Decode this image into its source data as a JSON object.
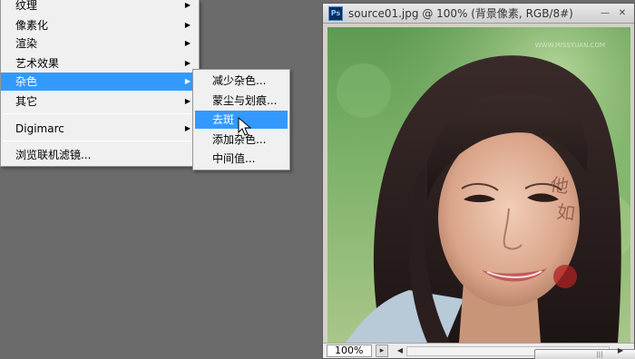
{
  "filter_menu": {
    "items": [
      {
        "label": "纹理",
        "has_submenu": true
      },
      {
        "label": "像素化",
        "has_submenu": true
      },
      {
        "label": "渲染",
        "has_submenu": true
      },
      {
        "label": "艺术效果",
        "has_submenu": true
      },
      {
        "label": "杂色",
        "has_submenu": true,
        "highlighted": true
      },
      {
        "label": "其它",
        "has_submenu": true
      },
      {
        "label": "Digimarc",
        "has_submenu": true
      },
      {
        "label": "浏览联机滤镜...",
        "has_submenu": false
      }
    ],
    "arrow_glyph": "▶"
  },
  "noise_submenu": {
    "items": [
      {
        "label": "减少杂色..."
      },
      {
        "label": "蒙尘与划痕..."
      },
      {
        "label": "去斑",
        "highlighted": true
      },
      {
        "label": "添加杂色..."
      },
      {
        "label": "中间值..."
      }
    ]
  },
  "document_window": {
    "app_icon_text": "Ps",
    "title": "source01.jpg @ 100% (背景像素, RGB/8#)",
    "minimize_glyph": "—",
    "close_glyph": "✕",
    "watermark_text": "WWW.MISSYUAN.COM",
    "status": {
      "zoom": "100%",
      "scroll_left_glyph": "◀",
      "scroll_right_glyph": "▶",
      "thumb_grip": "|||"
    }
  },
  "icons": {
    "pointer": "arrow-cursor-icon",
    "photoshop": "photoshop-icon"
  },
  "colors": {
    "menu_highlight": "#3399ff",
    "menu_bg": "#f0f0f0",
    "workspace_bg": "#6b6b6b"
  }
}
